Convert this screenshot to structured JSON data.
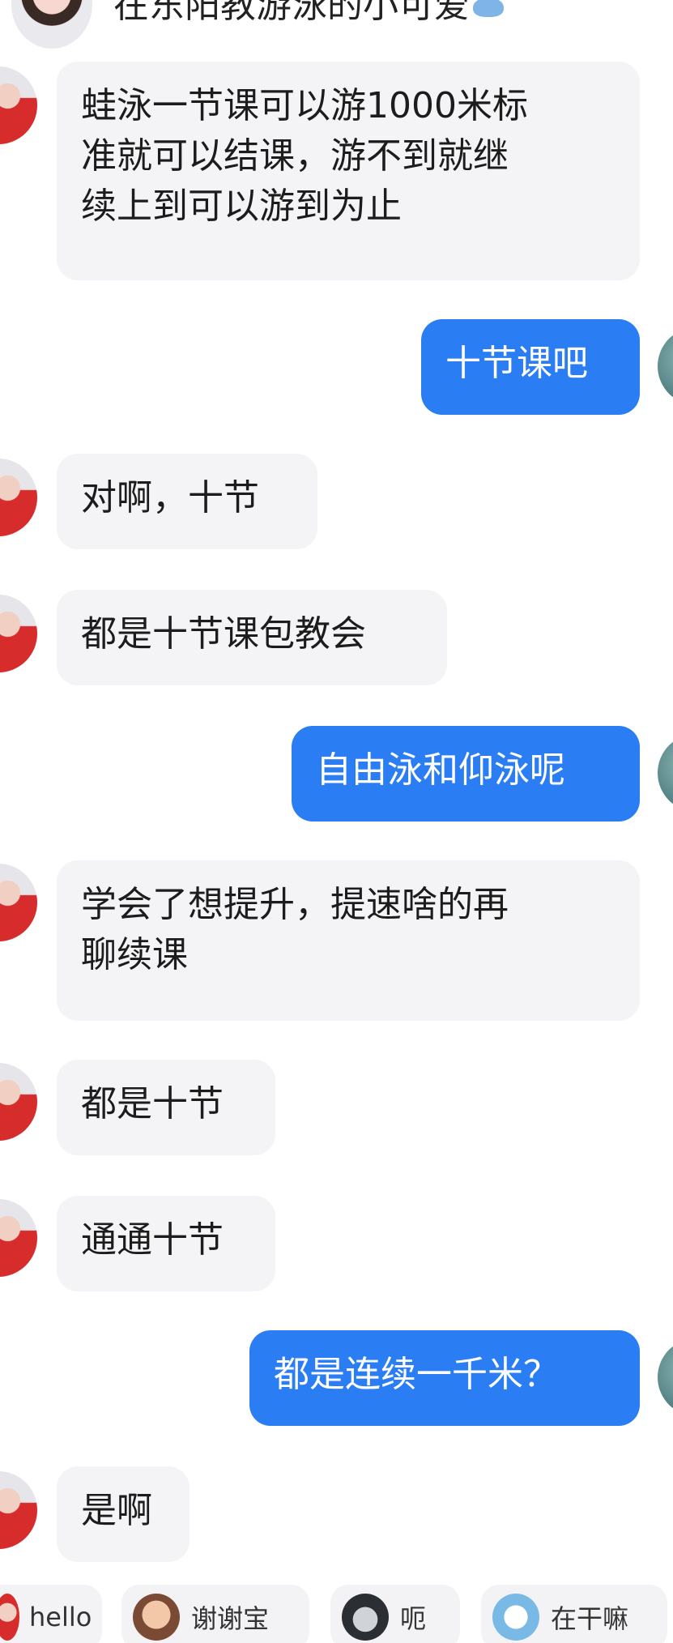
{
  "chat": {
    "header_title": "在东阳教游泳的小可爱",
    "messages": [
      {
        "side": "left",
        "text": "蛙泳一节课可以游1000米标\n准就可以结课，游不到就继\n续上到可以游到为止"
      },
      {
        "side": "right",
        "text": "十节课吧"
      },
      {
        "side": "left",
        "text": "对啊，十节"
      },
      {
        "side": "left",
        "text": "都是十节课包教会"
      },
      {
        "side": "right",
        "text": "自由泳和仰泳呢"
      },
      {
        "side": "left",
        "text": "学会了想提升，提速啥的再\n聊续课"
      },
      {
        "side": "left",
        "text": "都是十节"
      },
      {
        "side": "left",
        "text": "通通十节"
      },
      {
        "side": "right",
        "text": "都是连续一千米？"
      },
      {
        "side": "left",
        "text": "是啊"
      }
    ]
  },
  "quick_replies": [
    {
      "label": "hello",
      "icon": "avatar-icon"
    },
    {
      "label": "谢谢宝",
      "icon": "girl-sticker-icon"
    },
    {
      "label": "呃",
      "icon": "cat-sticker-icon"
    },
    {
      "label": "在干嘛",
      "icon": "doll-sticker-icon"
    }
  ],
  "colors": {
    "outgoing_bubble": "#2a7df2",
    "incoming_bubble": "#f4f4f6"
  }
}
